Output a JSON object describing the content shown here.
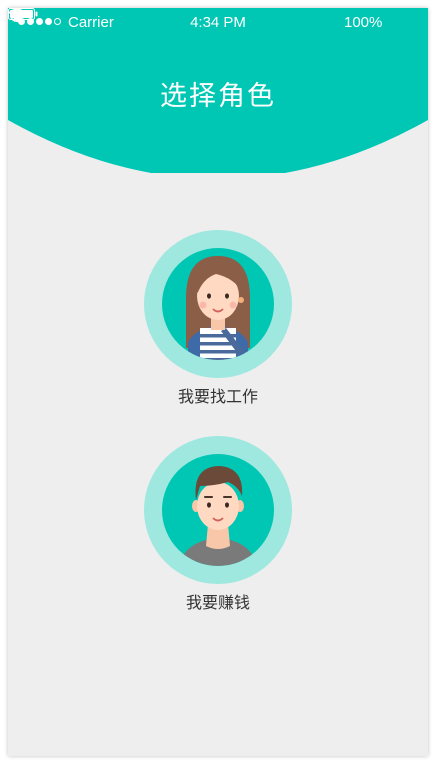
{
  "status_bar": {
    "carrier": "Carrier",
    "time": "4:34 PM",
    "battery": "100%",
    "signal_bars": 4,
    "signal_total": 5,
    "icons": [
      "signal-dots-icon",
      "wifi-icon",
      "orientation-lock-icon",
      "battery-icon"
    ]
  },
  "header": {
    "title": "选择角色"
  },
  "roles": [
    {
      "label": "我要找工作",
      "avatar_icon": "female-avatar-icon"
    },
    {
      "label": "我要赚钱",
      "avatar_icon": "male-avatar-icon"
    }
  ],
  "colors": {
    "accent": "#00C7B4",
    "avatar_ring": "#9EE8DF",
    "background": "#EEEEEE",
    "label_text": "#333333"
  }
}
